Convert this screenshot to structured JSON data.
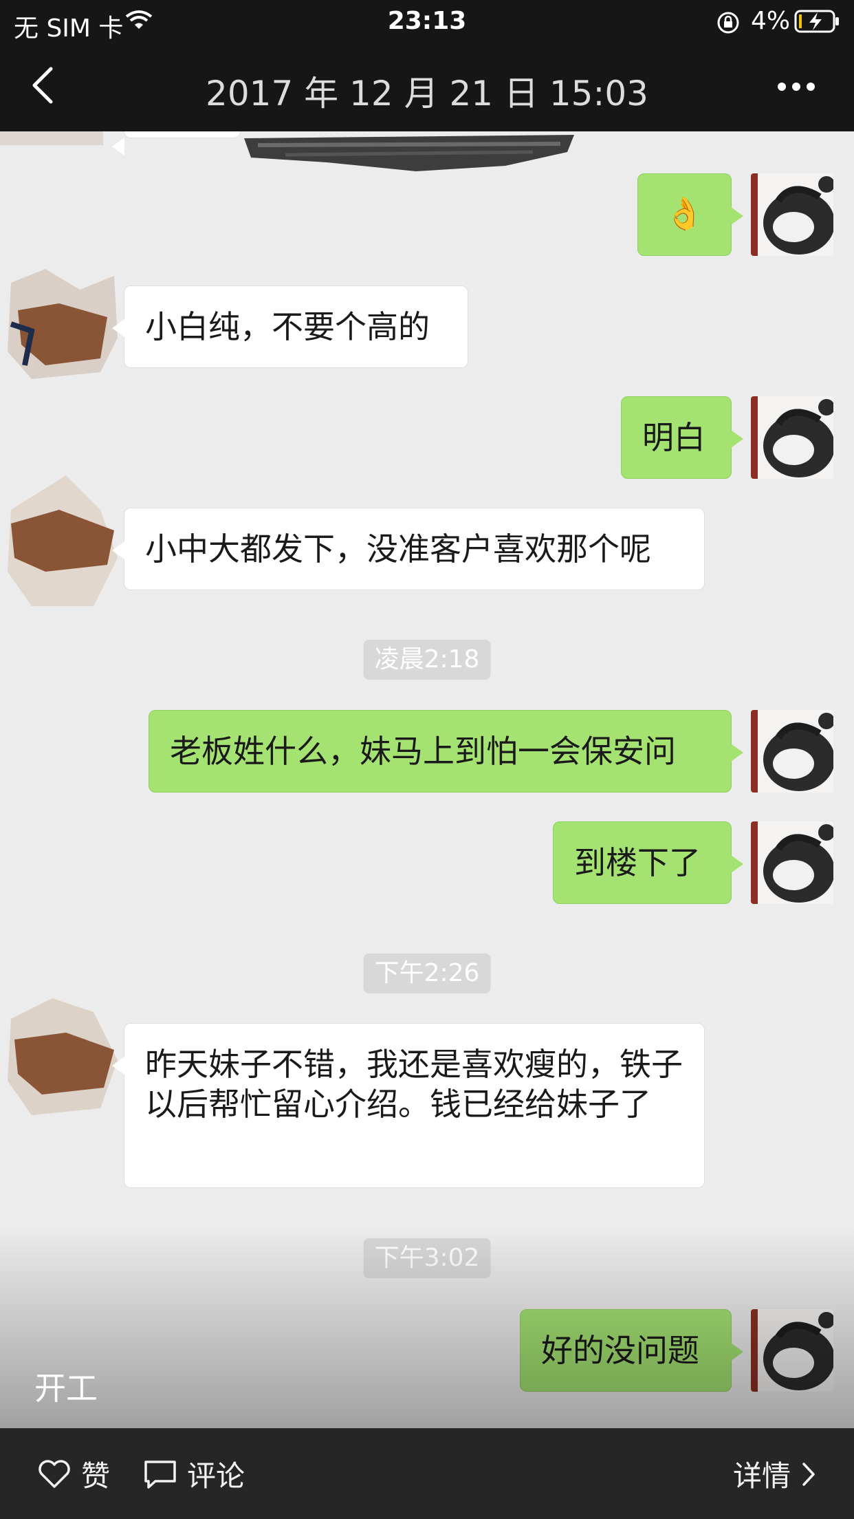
{
  "status_bar": {
    "carrier": "无 SIM 卡",
    "time": "23:13",
    "battery": "4%"
  },
  "header": {
    "title": "2017 年 12 月 21 日 15:03"
  },
  "messages": [
    {
      "side": "me",
      "text": "👌"
    },
    {
      "side": "other",
      "text": "小白纯，不要个高的"
    },
    {
      "side": "me",
      "text": "明白"
    },
    {
      "side": "other",
      "text": "小中大都发下，没准客户喜欢那个呢"
    },
    {
      "side": "time",
      "text": "凌晨2:18"
    },
    {
      "side": "me",
      "text": "老板姓什么，妹马上到怕一会保安问"
    },
    {
      "side": "me",
      "text": "到楼下了"
    },
    {
      "side": "time",
      "text": "下午2:26"
    },
    {
      "side": "other",
      "text": "昨天妹子不错，我还是喜欢瘦的，铁子以后帮忙留心介绍。钱已经给妹子了"
    },
    {
      "side": "time",
      "text": "下午3:02"
    },
    {
      "side": "me",
      "text": "好的没问题"
    }
  ],
  "caption": "开工",
  "bottom_bar": {
    "like_label": "赞",
    "comment_label": "评论",
    "details_label": "详情"
  },
  "colors": {
    "my_bubble": "#a4e272",
    "their_bubble": "#ffffff",
    "chat_background": "#ececec",
    "top_bar": "#161616",
    "bottom_bar": "#262626"
  }
}
